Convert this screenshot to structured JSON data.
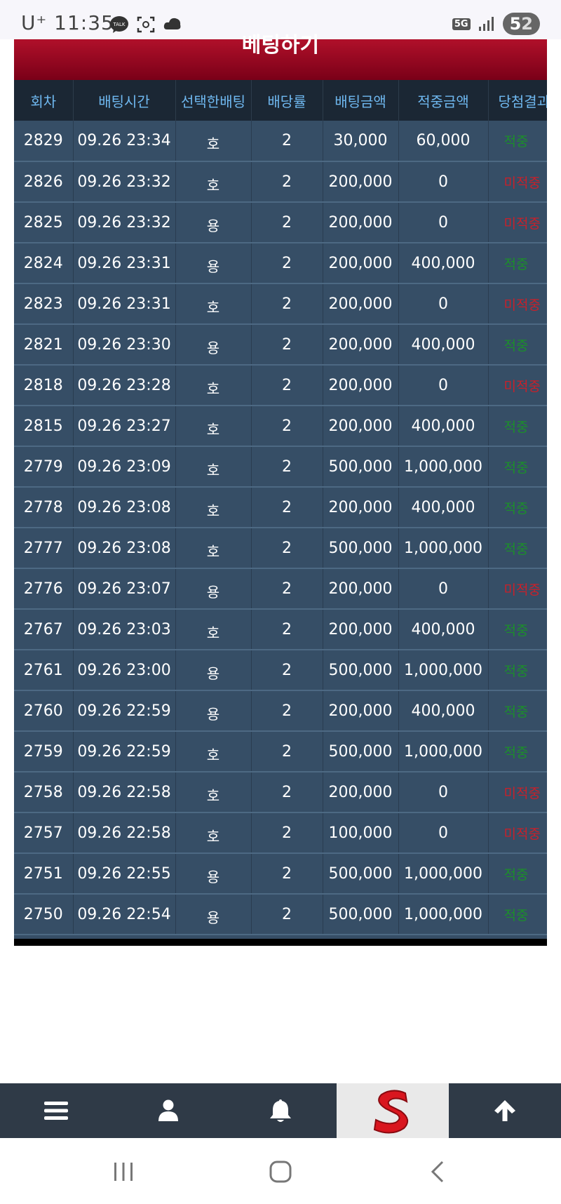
{
  "status": {
    "carrier": "U⁺ 11:35",
    "network": "5G",
    "battery_a": "5",
    "battery_b": "2"
  },
  "title": "베팅하기",
  "columns": [
    "회차",
    "배팅시간",
    "선택한배팅",
    "배당률",
    "배팅금액",
    "적중금액",
    "당첨결과"
  ],
  "rows": [
    [
      "2829",
      "09.26 23:34",
      "호",
      "2",
      "30,000",
      "60,000",
      "적중",
      "win"
    ],
    [
      "2826",
      "09.26 23:32",
      "호",
      "2",
      "200,000",
      "0",
      "미적중",
      "lose"
    ],
    [
      "2825",
      "09.26 23:32",
      "용",
      "2",
      "200,000",
      "0",
      "미적중",
      "lose"
    ],
    [
      "2824",
      "09.26 23:31",
      "용",
      "2",
      "200,000",
      "400,000",
      "적중",
      "win"
    ],
    [
      "2823",
      "09.26 23:31",
      "호",
      "2",
      "200,000",
      "0",
      "미적중",
      "lose"
    ],
    [
      "2821",
      "09.26 23:30",
      "용",
      "2",
      "200,000",
      "400,000",
      "적중",
      "win"
    ],
    [
      "2818",
      "09.26 23:28",
      "호",
      "2",
      "200,000",
      "0",
      "미적중",
      "lose"
    ],
    [
      "2815",
      "09.26 23:27",
      "호",
      "2",
      "200,000",
      "400,000",
      "적중",
      "win"
    ],
    [
      "2779",
      "09.26 23:09",
      "호",
      "2",
      "500,000",
      "1,000,000",
      "적중",
      "win"
    ],
    [
      "2778",
      "09.26 23:08",
      "호",
      "2",
      "200,000",
      "400,000",
      "적중",
      "win"
    ],
    [
      "2777",
      "09.26 23:08",
      "호",
      "2",
      "500,000",
      "1,000,000",
      "적중",
      "win"
    ],
    [
      "2776",
      "09.26 23:07",
      "용",
      "2",
      "200,000",
      "0",
      "미적중",
      "lose"
    ],
    [
      "2767",
      "09.26 23:03",
      "호",
      "2",
      "200,000",
      "400,000",
      "적중",
      "win"
    ],
    [
      "2761",
      "09.26 23:00",
      "용",
      "2",
      "500,000",
      "1,000,000",
      "적중",
      "win"
    ],
    [
      "2760",
      "09.26 22:59",
      "용",
      "2",
      "200,000",
      "400,000",
      "적중",
      "win"
    ],
    [
      "2759",
      "09.26 22:59",
      "호",
      "2",
      "500,000",
      "1,000,000",
      "적중",
      "win"
    ],
    [
      "2758",
      "09.26 22:58",
      "호",
      "2",
      "200,000",
      "0",
      "미적중",
      "lose"
    ],
    [
      "2757",
      "09.26 22:58",
      "호",
      "2",
      "100,000",
      "0",
      "미적중",
      "lose"
    ],
    [
      "2751",
      "09.26 22:55",
      "용",
      "2",
      "500,000",
      "1,000,000",
      "적중",
      "win"
    ],
    [
      "2750",
      "09.26 22:54",
      "용",
      "2",
      "500,000",
      "1,000,000",
      "적중",
      "win"
    ]
  ],
  "nav": [
    {
      "icon": "menu-icon"
    },
    {
      "icon": "user-icon"
    },
    {
      "icon": "bell-icon"
    },
    {
      "icon": "logo-icon"
    },
    {
      "icon": "arrow-up-icon"
    }
  ],
  "colors": {
    "header_bg": "#1b2734",
    "header_text": "#6fb8f0",
    "row_bg": "#364e66",
    "win": "#1c8f2a",
    "lose": "#c8202a",
    "title_red": "#9b0a22"
  }
}
